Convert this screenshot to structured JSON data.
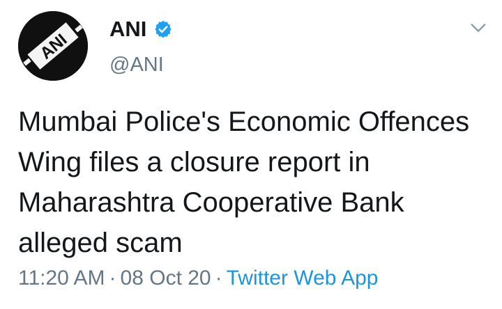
{
  "account": {
    "display_name": "ANI",
    "handle": "@ANI",
    "verified": true,
    "avatar_text": "ANI"
  },
  "tweet": {
    "text": "Mumbai Police's Economic Offences Wing files a closure report in Maharashtra Cooperative Bank alleged scam",
    "time": "11:20 AM",
    "separator": "·",
    "date": "08 Oct 20",
    "source": "Twitter Web App"
  },
  "icons": {
    "verified": "verified-badge-icon",
    "menu": "chevron-down-icon"
  },
  "colors": {
    "text": "#14171a",
    "muted": "#657786",
    "link": "#1b95e0",
    "verified": "#1da1f2"
  }
}
